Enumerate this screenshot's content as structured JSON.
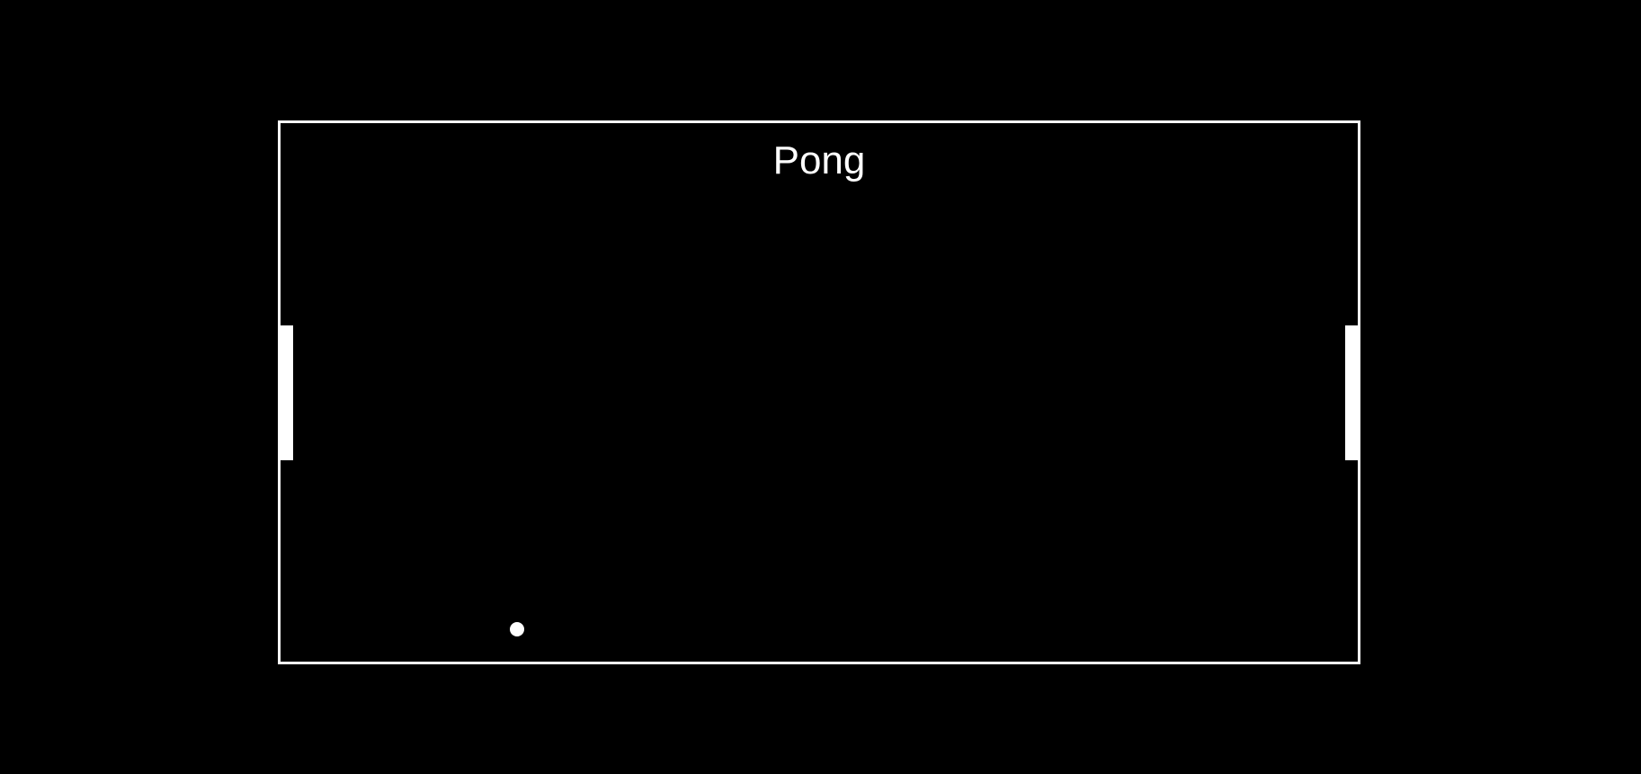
{
  "game": {
    "title": "Pong"
  },
  "colors": {
    "background": "#000000",
    "foreground": "#ffffff"
  }
}
